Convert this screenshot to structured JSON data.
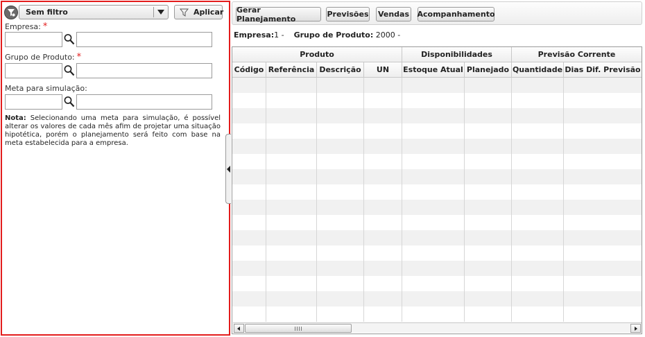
{
  "filter": {
    "selected": "Sem filtro",
    "apply_label": "Aplicar"
  },
  "fields": [
    {
      "label": "Empresa:",
      "required": "*",
      "code": "",
      "description": ""
    },
    {
      "label": "Grupo de Produto:",
      "required": "*",
      "code": "",
      "description": ""
    },
    {
      "label": "Meta para simulação:",
      "required": "",
      "code": "",
      "description": ""
    }
  ],
  "note": {
    "title": "Nota:",
    "text": "Selecionando  uma meta para simulação, é possível alterar os valores de cada mês afim de projetar uma situação hipotética, porém  o planejamento será feito com base na meta estabelecida para a empresa."
  },
  "toolbar": {
    "buttons": [
      "Gerar Planejamento",
      "Previsões",
      "Vendas",
      "Acompanhamento"
    ]
  },
  "info": {
    "empresa_label": "Empresa:",
    "empresa_value": "1 -",
    "grupo_label": "Grupo de Produto:",
    "grupo_value": "2000 -"
  },
  "grid": {
    "groups": [
      "Produto",
      "Disponibilidades",
      "Previsão Corrente"
    ],
    "columns": [
      "Código",
      "Referência",
      "Descrição",
      "UN",
      "Estoque Atual",
      "Planejado",
      "Quantidade",
      "Dias Dif. Previsão"
    ],
    "row_count": 16
  },
  "icons": {
    "filter": "filter-icon",
    "funnel": "funnel-icon",
    "lookup": "magnifier-icon",
    "collapse": "chevron-left-icon"
  },
  "colors": {
    "highlight_border": "#e31c1c",
    "required": "#e31c1c"
  }
}
